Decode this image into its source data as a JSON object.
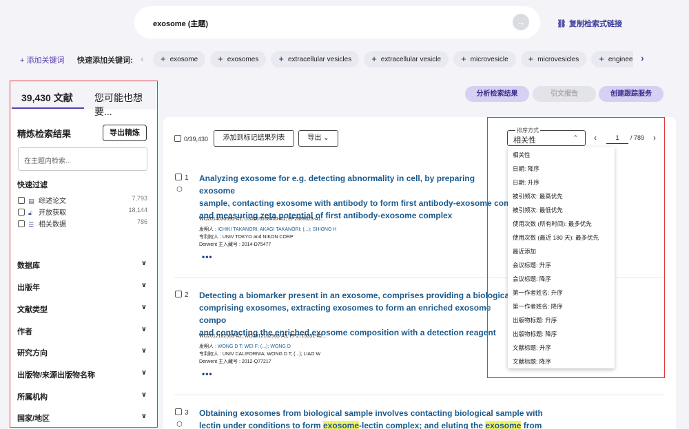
{
  "search": {
    "query": "exosome (主题)",
    "copy_link": "复制检索式链接"
  },
  "keywords": {
    "add_label": "+ 添加关键词",
    "quick_label": "快速添加关键词:",
    "chips": [
      "exosome",
      "exosomes",
      "extracellular vesicles",
      "extracellular vesicle",
      "microvesicle",
      "microvesicles",
      "enginee"
    ]
  },
  "left": {
    "tab_results": "39,430 文献",
    "tab_suggest": "您可能也想要...",
    "refine_title": "精炼检索结果",
    "export_refine": "导出精炼",
    "topic_search_placeholder": "在主题内检索...",
    "quick_filter_title": "快速过滤",
    "quick_filters": [
      {
        "label": "综述论文",
        "count": "7,793",
        "icon": "document-icon"
      },
      {
        "label": "开放获取",
        "count": "18,144",
        "icon": "lock-open-icon"
      },
      {
        "label": "相关数据",
        "count": "786",
        "icon": "database-icon"
      }
    ],
    "facets": [
      "数据库",
      "出版年",
      "文献类型",
      "作者",
      "研究方向",
      "出版物/来源出版物名称",
      "所属机构",
      "国家/地区"
    ]
  },
  "actions": {
    "analyze": "分析检索结果",
    "citation": "引文报告",
    "alert": "创建跟踪服务"
  },
  "results_toolbar": {
    "select_all": "0/39,430",
    "add_marked": "添加到标记结果列表",
    "export": "导出"
  },
  "sort": {
    "legend": "排序方式",
    "selected": "相关性",
    "options": [
      "相关性",
      "日期: 降序",
      "日期: 升序",
      "被引频次: 最高优先",
      "被引频次: 最低优先",
      "使用次数 (所有时间): 最多优先",
      "使用次数 (最近 180 天): 最多优先",
      "最近添加",
      "会议标题: 升序",
      "会议标题: 降序",
      "第一作者姓名: 升序",
      "第一作者姓名: 降序",
      "出版物标题: 升序",
      "出版物标题: 降序",
      "文献标题: 升序",
      "文献标题: 降序"
    ]
  },
  "pager": {
    "current": "1",
    "total": "/ 789"
  },
  "records": [
    {
      "num": "1",
      "title_lines": [
        "Analyzing exosome for e.g. detecting abnormality in cell, by preparing exosome",
        "sample, contacting exosome with antibody to form first antibody-exosome com",
        "and measuring zeta potential of first antibody-exosome complex"
      ],
      "patent_numbers": "WO2014030590-A1; US2015168400-A1; EP2889623-A1...",
      "inventor_label": "发明人 : ",
      "inventors": "ICHIKI TAKANORI; AKAGI TAKANORI; (...); SHIONO H",
      "assignee": "专利权人 : UNIV TOKYO and NIKON CORP",
      "derwent": "Derwent 主入藏号 : 2014-D75477"
    },
    {
      "num": "2",
      "title_lines": [
        "Detecting a biomarker present in an exosome, comprises providing a biological",
        "comprising exosomes, extracting exosomes to form an enriched exosome compo",
        "and contacting the enriched exosome composition with a detection reagent"
      ],
      "patent_numbers": "WO2012162563-A2; WO2012162563-A3; EP2715351-A2...",
      "inventor_label": "发明人 : ",
      "inventors": "WONG D T; WEI F; (...); WONG D",
      "assignee": "专利权人 : UNIV CALIFORNIA; WONG D T; (...); LIAO W",
      "derwent": "Derwent 主入藏号 : 2012-Q77217"
    },
    {
      "num": "3",
      "title_line1": "Obtaining exosomes from biological sample involves contacting biological sample with",
      "title_line2_a": "lectin under conditions to form ",
      "title_line2_hl1": "exosome",
      "title_line2_b": "-lectin complex; and eluting the ",
      "title_line2_hl2": "exosome",
      "title_line2_c": " from"
    }
  ],
  "colors": {
    "accent": "#5a3fb0",
    "link": "#1c5a8c",
    "highlight_frame": "#e0353b",
    "highlight_text": "#f2f26a"
  }
}
